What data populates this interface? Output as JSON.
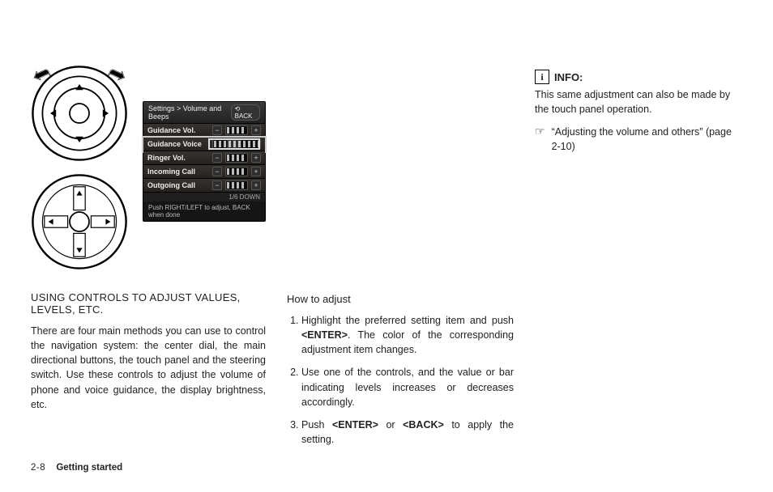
{
  "screen": {
    "breadcrumb": "Settings > Volume and Beeps",
    "back_label": "BACK",
    "rows": [
      {
        "label": "Guidance Vol."
      },
      {
        "label": "Guidance Voice"
      },
      {
        "label": "Ringer Vol."
      },
      {
        "label": "Incoming Call"
      },
      {
        "label": "Outgoing Call"
      }
    ],
    "highlight_index": 1,
    "pager": "1/6   DOWN",
    "hint_prefix": "Push RIGHT/LEFT to adjust, BACK when done"
  },
  "left": {
    "heading": "USING CONTROLS TO ADJUST VALUES, LEVELS, ETC.",
    "body": "There are four main methods you can use to control the navigation system: the center dial, the main directional buttons, the touch panel and the steering switch. Use these controls to adjust the volume of phone and voice guidance, the display brightness, etc."
  },
  "mid": {
    "heading": "How to adjust",
    "steps": [
      {
        "pre": "Highlight the preferred setting item and push ",
        "kw": "<ENTER>",
        "post": ". The color of the corresponding adjustment item changes."
      },
      {
        "pre": "Use one of the controls, and the value or bar indicating levels increases or decreases accordingly.",
        "kw": "",
        "post": ""
      },
      {
        "pre": "Push ",
        "kw": "<ENTER>",
        "mid": " or ",
        "kw2": "<BACK>",
        "post": " to apply the setting."
      }
    ]
  },
  "right": {
    "info_label": "INFO:",
    "info_body": "This same adjustment can also be made by the touch panel operation.",
    "xref_text": "“Adjusting the volume and others” (page 2-10)"
  },
  "footer": {
    "page": "2-8",
    "chapter": "Getting started"
  }
}
